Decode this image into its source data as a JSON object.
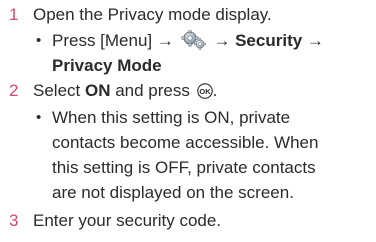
{
  "steps": [
    {
      "number": "1",
      "text": "Open the Privacy mode display."
    },
    {
      "number": "2",
      "text_prefix": "Select ",
      "text_bold": "ON",
      "text_mid": " and press ",
      "text_suffix": "."
    },
    {
      "number": "3",
      "text": "Enter your security code."
    }
  ],
  "bullet1": {
    "dot": "•",
    "press": "Press [Menu]",
    "arrow": "→",
    "security": "Security",
    "privacy_mode": "Privacy Mode"
  },
  "bullet2": {
    "dot": "•",
    "lines": [
      "When this setting is ON, private",
      "contacts become accessible. When",
      "this setting is OFF, private contacts",
      "are not displayed on the screen."
    ]
  },
  "icons": {
    "settings": "gear-icon",
    "ok": "ok-key-icon"
  },
  "colors": {
    "step_number": "#d24a6e",
    "text": "#2b2b2b"
  }
}
